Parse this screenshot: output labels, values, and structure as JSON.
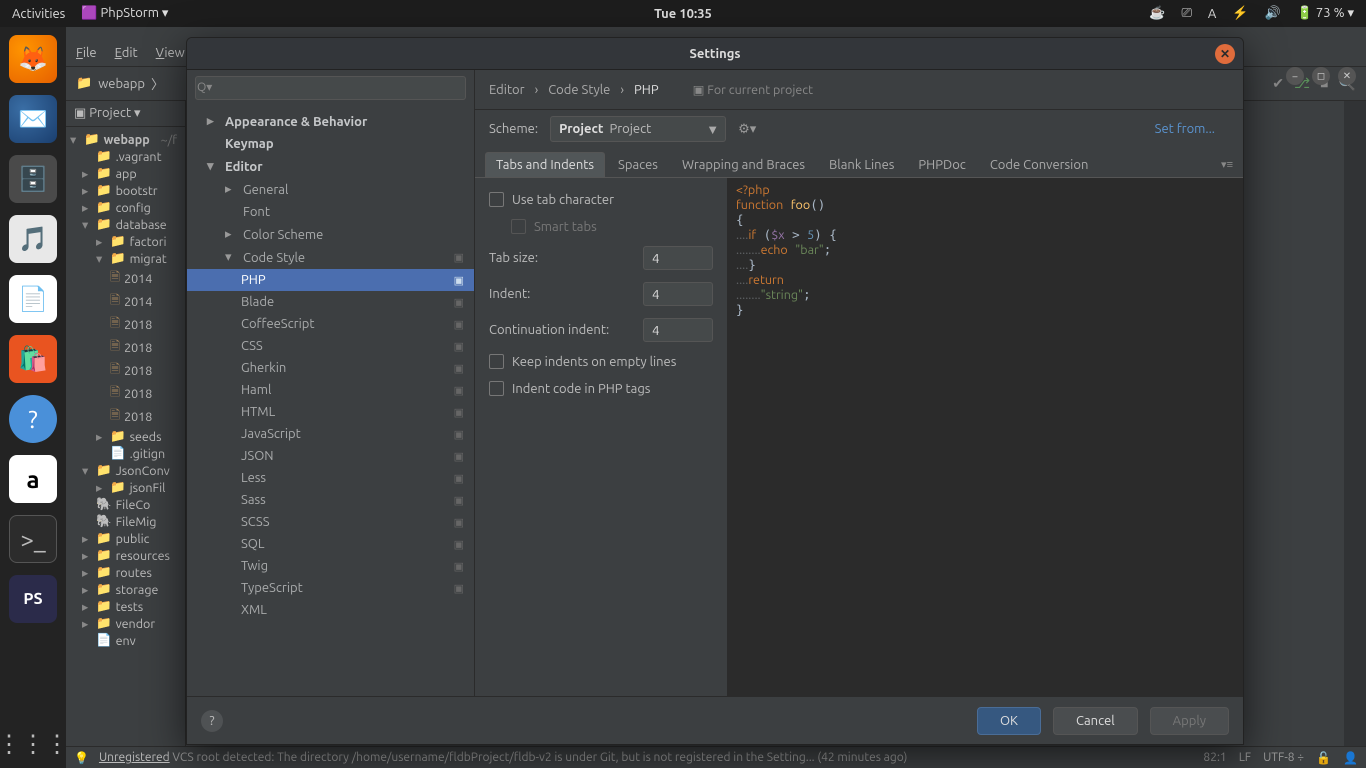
{
  "topbar": {
    "activities": "Activities",
    "app_label": "PhpStorm ▾",
    "clock": "Tue  10:35",
    "battery": "73 % ▾"
  },
  "ide": {
    "menu": {
      "file": "File",
      "edit": "Edit",
      "view": "View"
    },
    "crumb_project": "webapp",
    "toolbar_right_git": "⎇",
    "project_label": "Project ▾",
    "tree": {
      "root": "webapp",
      "root_suffix": "~/f",
      "vagrant": ".vagrant",
      "app": "app",
      "bootstrap": "bootstr",
      "config": "config",
      "database": "database",
      "factories": "factori",
      "migrations": "migrat",
      "f1": "2014",
      "f2": "2014",
      "f3": "2018",
      "f4": "2018",
      "f5": "2018",
      "f6": "2018",
      "f7": "2018",
      "seeds": "seeds",
      "gitign": ".gitign",
      "jsonconv": "JsonConv",
      "jsonfil": "jsonFil",
      "filecon": "FileCo",
      "filemig": "FileMig",
      "public": "public",
      "resources": "resources",
      "routes": "routes",
      "storage": "storage",
      "tests": "tests",
      "vendor": "vendor",
      "env": "env"
    }
  },
  "dialog": {
    "title": "Settings",
    "search_placeholder": "",
    "nav": {
      "appearance": "Appearance & Behavior",
      "keymap": "Keymap",
      "editor": "Editor",
      "general": "General",
      "font": "Font",
      "color_scheme": "Color Scheme",
      "code_style": "Code Style",
      "php": "PHP",
      "blade": "Blade",
      "coffee": "CoffeeScript",
      "css": "CSS",
      "gherkin": "Gherkin",
      "haml": "Haml",
      "html": "HTML",
      "javascript": "JavaScript",
      "json": "JSON",
      "less": "Less",
      "sass": "Sass",
      "scss": "SCSS",
      "sql": "SQL",
      "twig": "Twig",
      "typescript": "TypeScript",
      "xml": "XML"
    },
    "crumbs": {
      "a": "Editor",
      "b": "Code Style",
      "c": "PHP",
      "scope": "For current project"
    },
    "scheme_label": "Scheme:",
    "scheme_value": "Project",
    "scheme_extra": "Project",
    "set_from": "Set from...",
    "tabs": {
      "t1": "Tabs and Indents",
      "t2": "Spaces",
      "t3": "Wrapping and Braces",
      "t4": "Blank Lines",
      "t5": "PHPDoc",
      "t6": "Code Conversion"
    },
    "form": {
      "use_tab": "Use tab character",
      "smart_tabs": "Smart tabs",
      "tab_size_label": "Tab size:",
      "tab_size": "4",
      "indent_label": "Indent:",
      "indent": "4",
      "cont_label": "Continuation indent:",
      "cont": "4",
      "keep_empty": "Keep indents on empty lines",
      "indent_php": "Indent code in PHP tags"
    },
    "buttons": {
      "ok": "OK",
      "cancel": "Cancel",
      "apply": "Apply"
    }
  },
  "statusbar": {
    "msg_prefix": "Unregistered",
    "msg": " VCS root detected: The directory /home/username/fldbProject/fldb-v2 is under Git, but is not registered in the Setting... (42 minutes ago)",
    "pos": "82:1",
    "lf": "LF",
    "enc": "UTF-8"
  }
}
